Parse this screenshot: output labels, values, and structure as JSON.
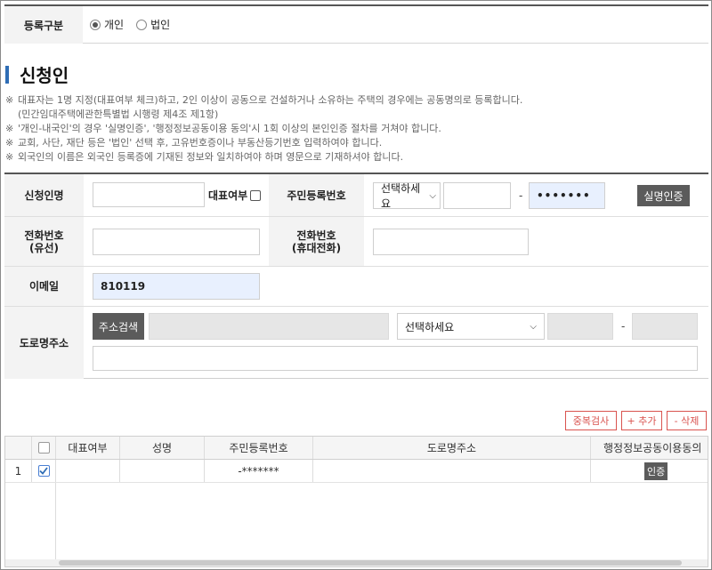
{
  "registration": {
    "label": "등록구분",
    "options": [
      {
        "label": "개인",
        "selected": true
      },
      {
        "label": "법인",
        "selected": false
      }
    ]
  },
  "section": {
    "title": "신청인"
  },
  "notices": {
    "mark": "※",
    "line1": "대표자는 1명 지정(대표여부 체크)하고, 2인 이상이 공동으로 건설하거나 소유하는 주택의 경우에는 공동명의로 등록합니다.",
    "line1_sub": "(민간임대주택에관한특별법 시행령 제4조 제1항)",
    "line2": "'개인-내국인'의 경우 '실명인증', '행정정보공동이용 동의'시 1회 이상의 본인인증 절차를 거쳐야 합니다.",
    "line3": "교회, 사단, 재단 등은 '법인' 선택 후, 고유번호증이나 부동산등기번호 입력하여야 합니다.",
    "line4": "외국인의 이름은 외국인 등록증에 기재된 정보와 일치하여야 하며 영문으로 기재하셔야 합니다."
  },
  "form": {
    "applicant_name_label": "신청인명",
    "applicant_name_value": "",
    "representative_label": "대표여부",
    "representative_checked": false,
    "resident_number_label": "주민등록번호",
    "resident_select": "선택하세요",
    "resident_front": "",
    "resident_separator": "-",
    "resident_back": "•••••••",
    "real_name_auth_button": "실명인증",
    "phone_label_line1": "전화번호",
    "phone_label_line2": "(유선)",
    "phone_value": "",
    "mobile_label_line1": "전화번호",
    "mobile_label_line2": "(휴대전화)",
    "mobile_value": "",
    "email_label": "이메일",
    "email_value": "810119",
    "road_address_label": "도로명주소",
    "address_search_button": "주소검색",
    "address_main": "",
    "address_select": "선택하세요",
    "address_code1": "",
    "address_separator": "-",
    "address_code2": "",
    "address_detail": ""
  },
  "actions": {
    "duplicate_check": "중복검사",
    "add": "+ 추가",
    "delete": "- 삭제"
  },
  "grid": {
    "columns": [
      "대표여부",
      "성명",
      "주민등록번호",
      "도로명주소",
      "행정정보공동이용동의"
    ],
    "rows": [
      {
        "no": "1",
        "checked": true,
        "representative": "",
        "name": "",
        "resident_number": "-*******",
        "address": "",
        "consent_button": "인증"
      }
    ]
  },
  "colors": {
    "accent": "#2f6db5",
    "danger": "#d9534f",
    "dark_button": "#5b5b5b",
    "autofill": "#e8f0fe"
  }
}
